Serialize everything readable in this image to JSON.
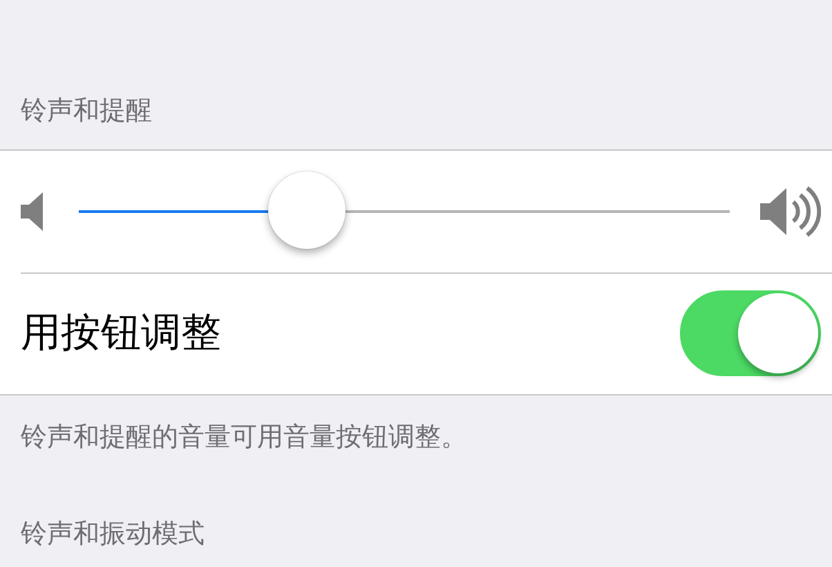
{
  "sections": [
    {
      "header": "铃声和提醒",
      "rows": [
        {
          "kind": "slider",
          "level": 0.35
        },
        {
          "kind": "toggle",
          "label": "用按钮调整",
          "on": true
        }
      ],
      "footer": "铃声和提醒的音量可用音量按钮调整。"
    },
    {
      "header": "铃声和振动模式"
    }
  ]
}
